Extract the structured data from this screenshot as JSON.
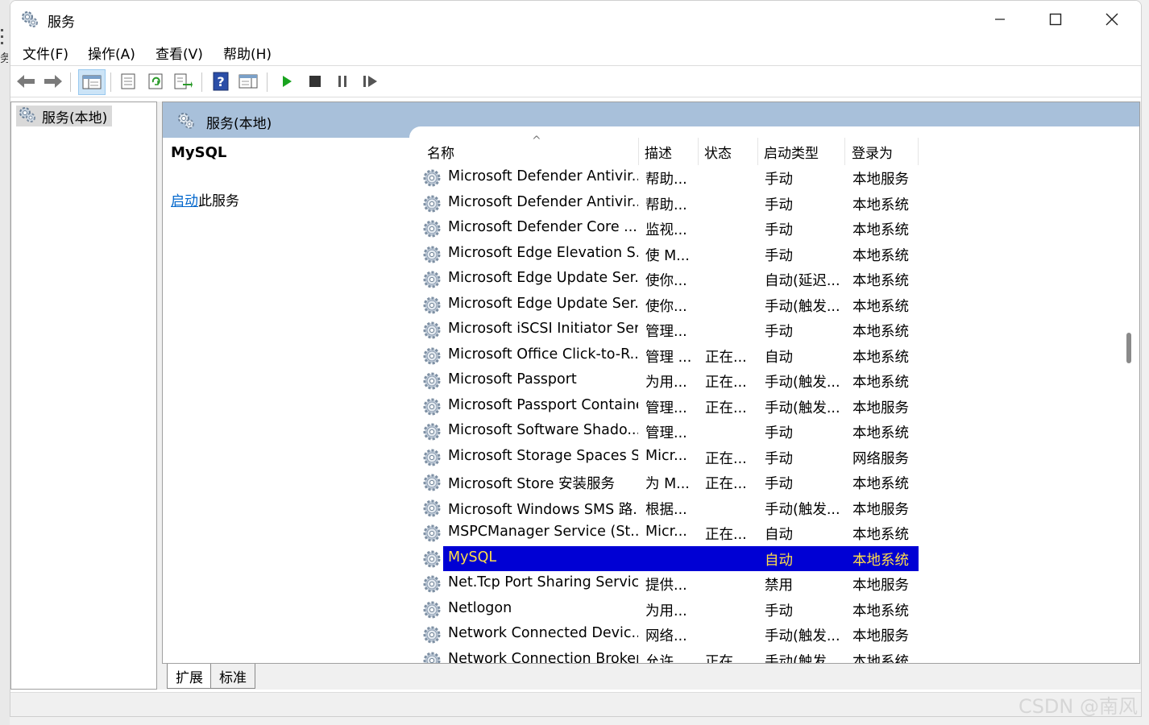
{
  "window": {
    "title": "服务",
    "icon": "gears-icon"
  },
  "background_window": {
    "fragment": "务"
  },
  "menu": [
    {
      "label": "文件(F)"
    },
    {
      "label": "操作(A)"
    },
    {
      "label": "查看(V)"
    },
    {
      "label": "帮助(H)"
    }
  ],
  "toolbar": {
    "buttons": [
      "back-arrow-icon",
      "forward-arrow-icon",
      "console-tree-icon",
      "properties-icon",
      "refresh-icon",
      "export-list-icon",
      "help-icon",
      "show-hide-action-pane-icon",
      "start-service-icon",
      "stop-service-icon",
      "pause-service-icon",
      "resume-service-icon"
    ],
    "active": "console-tree-icon"
  },
  "tree": {
    "items": [
      {
        "label": "服务(本地)"
      }
    ]
  },
  "panel": {
    "header_title": "服务(本地)",
    "selected_service_name": "MySQL",
    "action_link": "启动",
    "action_suffix": "此服务"
  },
  "list": {
    "columns": [
      {
        "label": "名称"
      },
      {
        "label": "描述"
      },
      {
        "label": "状态"
      },
      {
        "label": "启动类型"
      },
      {
        "label": "登录为"
      }
    ],
    "rows": [
      {
        "name": "Microsoft Defender Antivir...",
        "desc": "帮助...",
        "status": "",
        "startup": "手动",
        "logon": "本地服务"
      },
      {
        "name": "Microsoft Defender Antivir...",
        "desc": "帮助...",
        "status": "",
        "startup": "手动",
        "logon": "本地系统"
      },
      {
        "name": "Microsoft Defender Core ...",
        "desc": "监视...",
        "status": "",
        "startup": "手动",
        "logon": "本地系统"
      },
      {
        "name": "Microsoft Edge Elevation S...",
        "desc": "使 M...",
        "status": "",
        "startup": "手动",
        "logon": "本地系统"
      },
      {
        "name": "Microsoft Edge Update Ser...",
        "desc": "使你...",
        "status": "",
        "startup": "自动(延迟...",
        "logon": "本地系统"
      },
      {
        "name": "Microsoft Edge Update Ser...",
        "desc": "使你...",
        "status": "",
        "startup": "手动(触发...",
        "logon": "本地系统"
      },
      {
        "name": "Microsoft iSCSI Initiator Ser...",
        "desc": "管理...",
        "status": "",
        "startup": "手动",
        "logon": "本地系统"
      },
      {
        "name": "Microsoft Office Click-to-R...",
        "desc": "管理 ...",
        "status": "正在...",
        "startup": "自动",
        "logon": "本地系统"
      },
      {
        "name": "Microsoft Passport",
        "desc": "为用...",
        "status": "正在...",
        "startup": "手动(触发...",
        "logon": "本地系统"
      },
      {
        "name": "Microsoft Passport Container",
        "desc": "管理...",
        "status": "正在...",
        "startup": "手动(触发...",
        "logon": "本地服务"
      },
      {
        "name": "Microsoft Software Shado...",
        "desc": "管理...",
        "status": "",
        "startup": "手动",
        "logon": "本地系统"
      },
      {
        "name": "Microsoft Storage Spaces S...",
        "desc": "Micr...",
        "status": "正在...",
        "startup": "手动",
        "logon": "网络服务"
      },
      {
        "name": "Microsoft Store 安装服务",
        "desc": "为 M...",
        "status": "正在...",
        "startup": "手动",
        "logon": "本地系统"
      },
      {
        "name": "Microsoft Windows SMS 路...",
        "desc": "根据...",
        "status": "",
        "startup": "手动(触发...",
        "logon": "本地服务"
      },
      {
        "name": "MSPCManager Service (St...",
        "desc": "Micr...",
        "status": "正在...",
        "startup": "自动",
        "logon": "本地系统"
      },
      {
        "name": "MySQL",
        "desc": "",
        "status": "",
        "startup": "自动",
        "logon": "本地系统",
        "selected": true
      },
      {
        "name": "Net.Tcp Port Sharing Service",
        "desc": "提供...",
        "status": "",
        "startup": "禁用",
        "logon": "本地服务"
      },
      {
        "name": "Netlogon",
        "desc": "为用...",
        "status": "",
        "startup": "手动",
        "logon": "本地系统"
      },
      {
        "name": "Network Connected Devic...",
        "desc": "网络...",
        "status": "",
        "startup": "手动(触发...",
        "logon": "本地服务"
      },
      {
        "name": "Network Connection Broker",
        "desc": "允许...",
        "status": "正在...",
        "startup": "手动(触发...",
        "logon": "本地系统"
      }
    ]
  },
  "bottom_tabs": [
    {
      "label": "扩展",
      "active": true
    },
    {
      "label": "标准",
      "active": false
    }
  ],
  "watermark": "CSDN @南风",
  "colors": {
    "selection": "#0000d4",
    "selection_text": "#ffde4a",
    "panel_header": "#a8c0da",
    "link": "#0066cc"
  }
}
